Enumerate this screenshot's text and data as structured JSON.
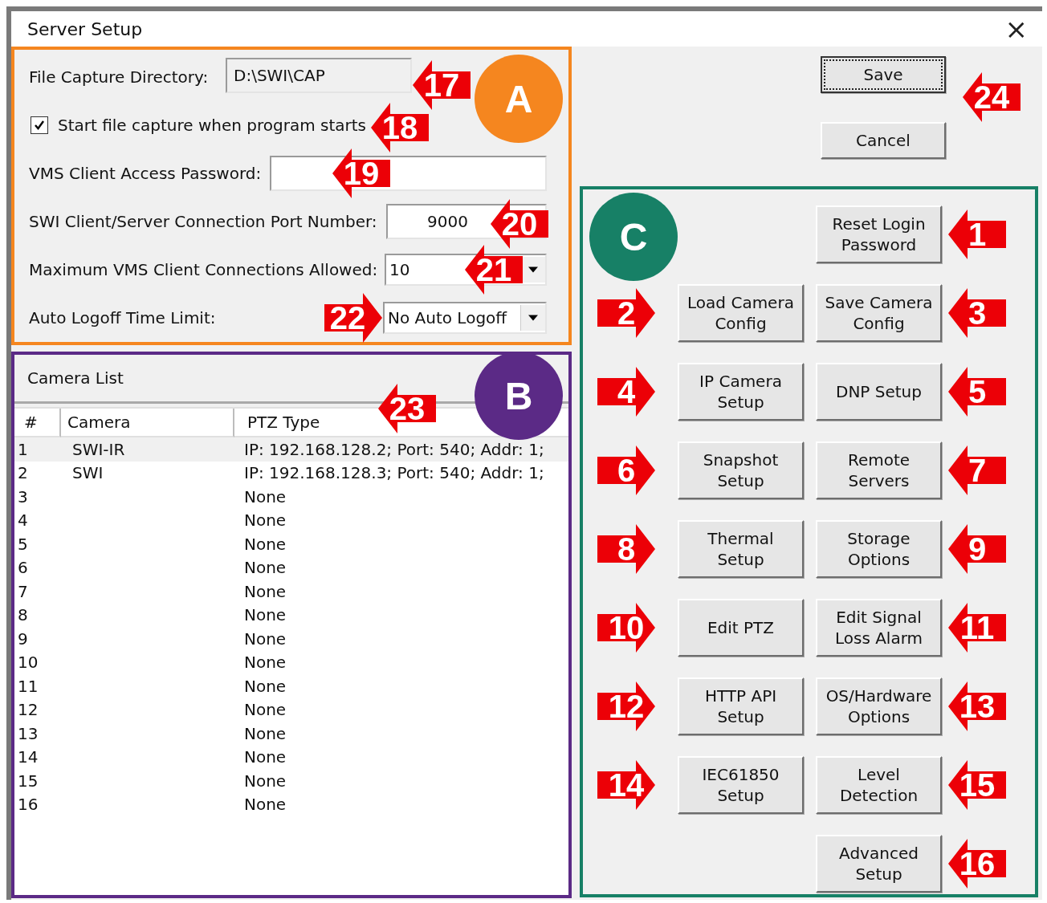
{
  "window": {
    "title": "Server Setup",
    "close": "×"
  },
  "section_a": {
    "badge": "A",
    "color": "#f5861f",
    "rows": [
      {
        "kind": "field",
        "label": "File Capture Directory:",
        "value": "D:\\SWI\\CAP",
        "readonly": true,
        "callout": "17",
        "callout_points_right": false
      },
      {
        "kind": "checkbox",
        "label": "Start file capture when program starts",
        "checked": true,
        "callout": "18",
        "callout_points_right": false
      },
      {
        "kind": "field",
        "label": "VMS Client Access Password:",
        "value": "",
        "readonly": false,
        "callout": "19",
        "callout_points_right": false
      },
      {
        "kind": "number",
        "label": "SWI Client/Server Connection Port Number:",
        "value": "9000",
        "readonly": false,
        "callout": "20",
        "callout_points_right": false
      },
      {
        "kind": "combo",
        "label": "Maximum VMS Client Connections Allowed:",
        "value": "10",
        "callout": "21",
        "callout_points_right": false
      },
      {
        "kind": "combo",
        "label": "Auto Logoff Time Limit:",
        "value": "No Auto Logoff",
        "callout": "22",
        "callout_points_right": true
      }
    ]
  },
  "section_b": {
    "badge": "B",
    "color": "#5b2a86",
    "title": "Camera List",
    "callout": "23",
    "columns": [
      "#",
      "Camera",
      "PTZ Type"
    ],
    "rows": [
      {
        "cells": [
          "1",
          "SWI-IR",
          "IP: 192.168.128.2; Port: 540; Addr: 1;"
        ],
        "selected": true
      },
      {
        "cells": [
          "2",
          "SWI",
          "IP: 192.168.128.3; Port: 540; Addr: 1;"
        ],
        "selected": false
      },
      {
        "cells": [
          "3",
          "",
          "None"
        ],
        "selected": false
      },
      {
        "cells": [
          "4",
          "",
          "None"
        ],
        "selected": false
      },
      {
        "cells": [
          "5",
          "",
          "None"
        ],
        "selected": false
      },
      {
        "cells": [
          "6",
          "",
          "None"
        ],
        "selected": false
      },
      {
        "cells": [
          "7",
          "",
          "None"
        ],
        "selected": false
      },
      {
        "cells": [
          "8",
          "",
          "None"
        ],
        "selected": false
      },
      {
        "cells": [
          "9",
          "",
          "None"
        ],
        "selected": false
      },
      {
        "cells": [
          "10",
          "",
          "None"
        ],
        "selected": false
      },
      {
        "cells": [
          "11",
          "",
          "None"
        ],
        "selected": false
      },
      {
        "cells": [
          "12",
          "",
          "None"
        ],
        "selected": false
      },
      {
        "cells": [
          "13",
          "",
          "None"
        ],
        "selected": false
      },
      {
        "cells": [
          "14",
          "",
          "None"
        ],
        "selected": false
      },
      {
        "cells": [
          "15",
          "",
          "None"
        ],
        "selected": false
      },
      {
        "cells": [
          "16",
          "",
          "None"
        ],
        "selected": false
      }
    ]
  },
  "dialog_buttons": [
    {
      "label": "Save",
      "focused": true
    },
    {
      "label": "Cancel",
      "focused": false
    }
  ],
  "dialog_callout": {
    "text": "24"
  },
  "section_c": {
    "badge": "C",
    "color": "#178066",
    "rows": [
      {
        "right": {
          "label": "Reset Login Password",
          "callout": "1"
        }
      },
      {
        "left": {
          "label": "Load Camera Config",
          "callout": "2"
        },
        "right": {
          "label": "Save Camera Config",
          "callout": "3"
        }
      },
      {
        "left": {
          "label": "IP Camera Setup",
          "callout": "4"
        },
        "right": {
          "label": "DNP Setup",
          "callout": "5"
        }
      },
      {
        "left": {
          "label": "Snapshot Setup",
          "callout": "6"
        },
        "right": {
          "label": "Remote Servers",
          "callout": "7"
        }
      },
      {
        "left": {
          "label": "Thermal Setup",
          "callout": "8"
        },
        "right": {
          "label": "Storage Options",
          "callout": "9"
        }
      },
      {
        "left": {
          "label": "Edit PTZ",
          "callout": "10"
        },
        "right": {
          "label": "Edit Signal Loss Alarm",
          "callout": "11"
        }
      },
      {
        "left": {
          "label": "HTTP API Setup",
          "callout": "12"
        },
        "right": {
          "label": "OS/Hardware Options",
          "callout": "13"
        }
      },
      {
        "left": {
          "label": "IEC61850 Setup",
          "callout": "14"
        },
        "right": {
          "label": "Level Detection",
          "callout": "15"
        }
      },
      {
        "right": {
          "label": "Advanced Setup",
          "callout": "16"
        }
      }
    ]
  }
}
